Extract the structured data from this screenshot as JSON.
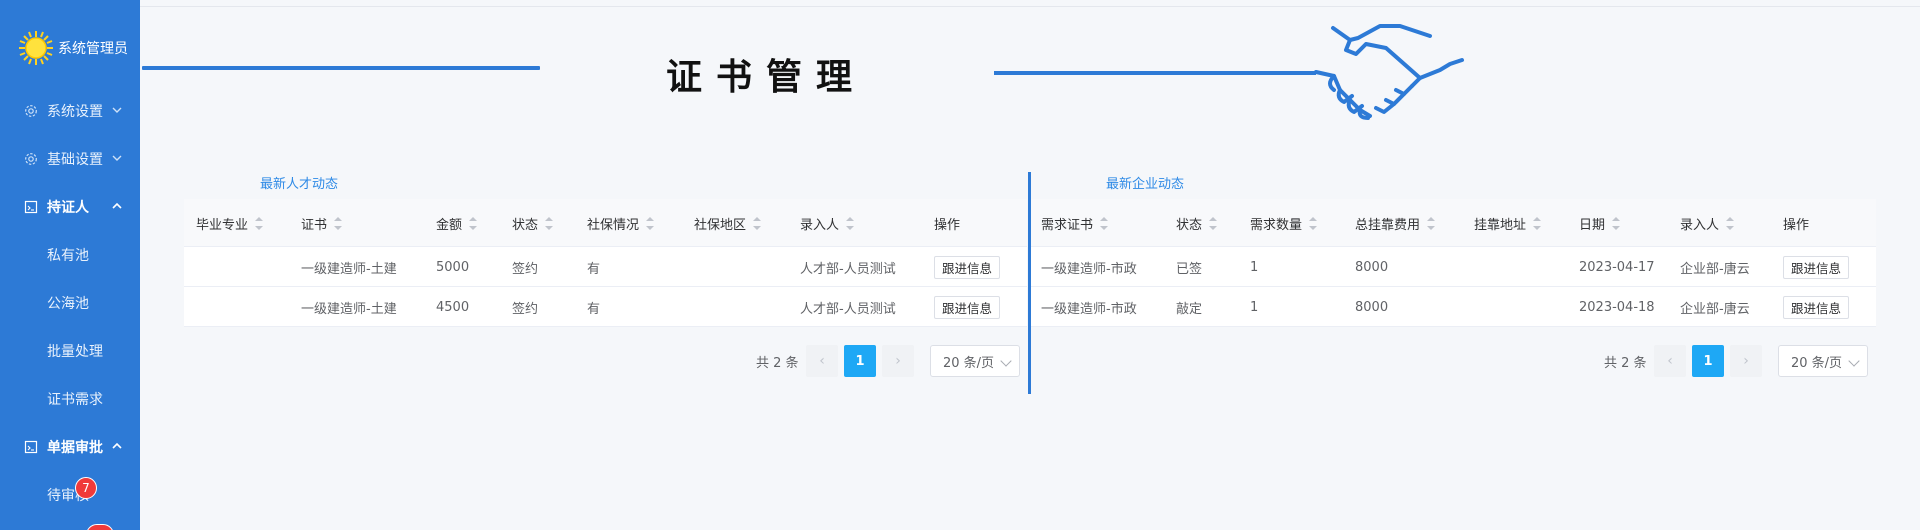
{
  "sidebar": {
    "title": "系统管理员",
    "items": [
      {
        "label": "系统设置",
        "icon": "gear-icon"
      },
      {
        "label": "基础设置",
        "icon": "gear-icon"
      },
      {
        "label": "持证人",
        "icon": "document-icon"
      },
      {
        "label": "私有池"
      },
      {
        "label": "公海池"
      },
      {
        "label": "批量处理"
      },
      {
        "label": "证书需求"
      },
      {
        "label": "单据审批",
        "icon": "document-icon"
      },
      {
        "label": "待审核",
        "badge": "7"
      }
    ]
  },
  "banner": {
    "title": "证书管理"
  },
  "left_panel": {
    "title": "最新人才动态",
    "columns": [
      "毕业专业",
      "证书",
      "金额",
      "状态",
      "社保情况",
      "社保地区",
      "录入人",
      "操作"
    ],
    "rows": [
      {
        "major": "",
        "cert": "一级建造师-土建",
        "amount": "5000",
        "status": "签约",
        "social": "有",
        "region": "",
        "entry": "人才部-人员测试",
        "action": "跟进信息"
      },
      {
        "major": "",
        "cert": "一级建造师-土建",
        "amount": "4500",
        "status": "签约",
        "social": "有",
        "region": "",
        "entry": "人才部-人员测试",
        "action": "跟进信息"
      }
    ],
    "pager": {
      "total": "共 2 条",
      "page": "1",
      "size": "20 条/页"
    }
  },
  "right_panel": {
    "title": "最新企业动态",
    "columns": [
      "需求证书",
      "状态",
      "需求数量",
      "总挂靠费用",
      "挂靠地址",
      "日期",
      "录入人",
      "操作"
    ],
    "rows": [
      {
        "cert": "一级建造师-市政",
        "status": "已签",
        "qty": "1",
        "fee": "8000",
        "addr": "",
        "date": "2023-04-17",
        "entry": "企业部-唐云",
        "action": "跟进信息"
      },
      {
        "cert": "一级建造师-市政",
        "status": "敲定",
        "qty": "1",
        "fee": "8000",
        "addr": "",
        "date": "2023-04-18",
        "entry": "企业部-唐云",
        "action": "跟进信息"
      }
    ],
    "pager": {
      "total": "共 2 条",
      "page": "1",
      "size": "20 条/页"
    }
  },
  "colors": {
    "sidebar": "#2d7ad6",
    "accent": "#1ea8f5",
    "badge": "#f03a3a"
  }
}
